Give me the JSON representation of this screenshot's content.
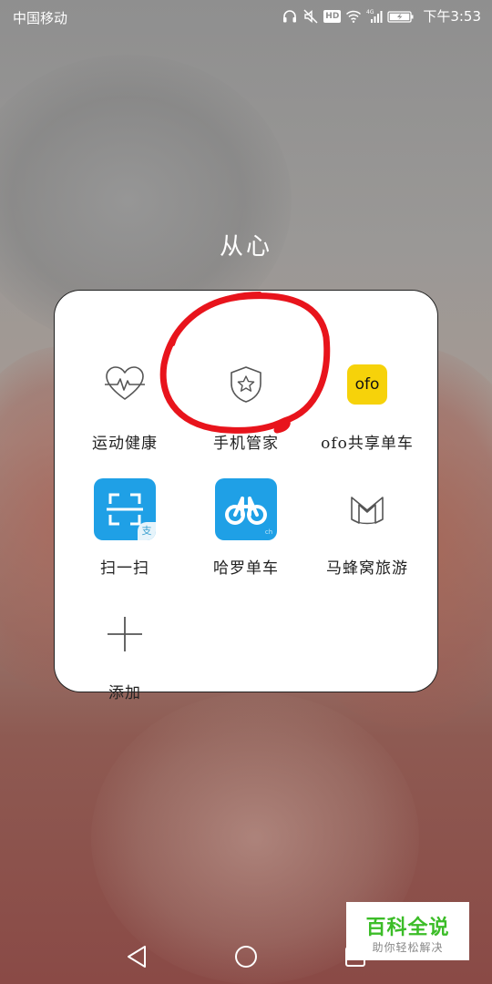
{
  "status_bar": {
    "carrier": "中国移动",
    "network": "4G",
    "time": "下午3:53",
    "hd_label": "HD"
  },
  "folder": {
    "title": "从心",
    "apps": [
      {
        "label": "运动健康",
        "icon": "heart-pulse-icon"
      },
      {
        "label": "手机管家",
        "icon": "shield-star-icon"
      },
      {
        "label": "ofo共享单车",
        "icon": "ofo-logo-icon",
        "icon_text": "ofo"
      },
      {
        "label": "扫一扫",
        "icon": "scan-icon",
        "badge": "支"
      },
      {
        "label": "哈罗单车",
        "icon": "hellobike-icon"
      },
      {
        "label": "马蜂窝旅游",
        "icon": "mafengwo-icon"
      },
      {
        "label": "添加",
        "icon": "plus-icon"
      }
    ]
  },
  "watermark": {
    "main": "百科全说",
    "sub": "助你轻松解决"
  },
  "colors": {
    "panel_bg": "#ffffff",
    "alipay_blue": "#1fa0e6",
    "ofo_yellow": "#f6d20a",
    "annotation_red": "#e8141c",
    "watermark_green": "#3cbd28"
  }
}
